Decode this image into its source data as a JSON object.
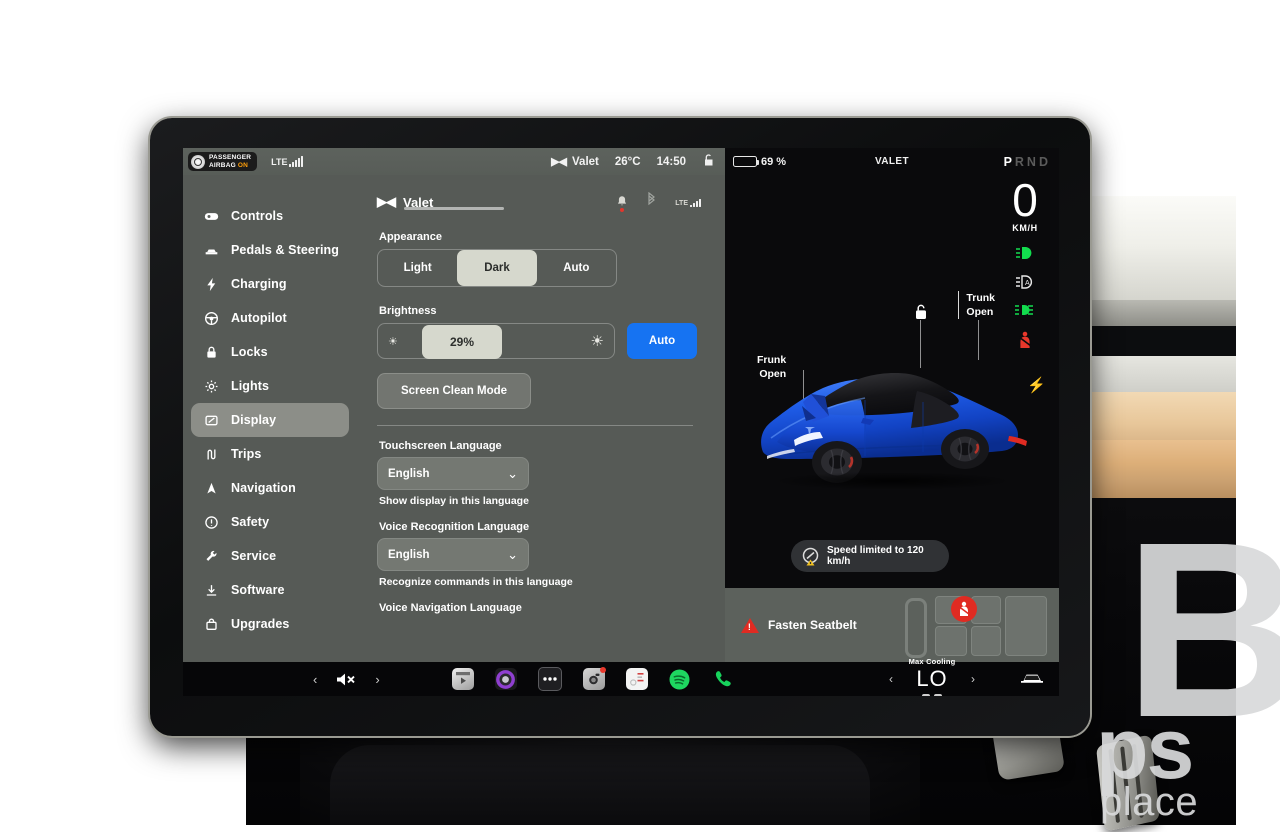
{
  "status_bar": {
    "airbag_badge": {
      "line1": "PASSENGER",
      "line2": "AIRBAG",
      "state": "ON"
    },
    "network_label": "LTE",
    "valet_label": "Valet",
    "temperature": "26°C",
    "time": "14:50"
  },
  "sidebar": {
    "items": [
      {
        "label": "Controls",
        "icon": "toggle-icon"
      },
      {
        "label": "Pedals & Steering",
        "icon": "car-icon"
      },
      {
        "label": "Charging",
        "icon": "bolt-icon"
      },
      {
        "label": "Autopilot",
        "icon": "steering-wheel-icon"
      },
      {
        "label": "Locks",
        "icon": "lock-icon"
      },
      {
        "label": "Lights",
        "icon": "sun-icon"
      },
      {
        "label": "Display",
        "icon": "display-icon"
      },
      {
        "label": "Trips",
        "icon": "road-icon"
      },
      {
        "label": "Navigation",
        "icon": "navigation-arrow-icon"
      },
      {
        "label": "Safety",
        "icon": "exclamation-circle-icon"
      },
      {
        "label": "Service",
        "icon": "wrench-icon"
      },
      {
        "label": "Software",
        "icon": "download-icon"
      },
      {
        "label": "Upgrades",
        "icon": "bag-icon"
      }
    ],
    "active": "Display"
  },
  "content": {
    "header_title": "Valet",
    "appearance": {
      "label": "Appearance",
      "options": [
        "Light",
        "Dark",
        "Auto"
      ],
      "selected": "Dark"
    },
    "brightness": {
      "label": "Brightness",
      "value": "29%",
      "auto_label": "Auto"
    },
    "screen_clean": "Screen Clean Mode",
    "touchscreen_language": {
      "label": "Touchscreen Language",
      "value": "English",
      "hint": "Show display in this language"
    },
    "voice_recognition_language": {
      "label": "Voice Recognition Language",
      "value": "English",
      "hint": "Recognize commands in this language"
    },
    "voice_navigation_language": {
      "label": "Voice Navigation Language"
    }
  },
  "vehicle": {
    "battery_percent": "69 %",
    "valet_mode": "VALET",
    "gear": {
      "all": "PRND",
      "selected": "P"
    },
    "speed": "0",
    "speed_unit": "KM/H",
    "trunk_status": {
      "line1": "Trunk",
      "line2": "Open"
    },
    "frunk_status": {
      "line1": "Frunk",
      "line2": "Open"
    },
    "speed_limit_notice": "Speed limited to 120 km/h",
    "indicators": [
      {
        "name": "high-beam-icon",
        "color": "#12dc4e"
      },
      {
        "name": "auto-beam-icon",
        "color": "#e8e8e8"
      },
      {
        "name": "fog-light-icon",
        "color": "#12dc4e"
      },
      {
        "name": "seatbelt-warning-icon",
        "color": "#e8372b"
      },
      {
        "name": "charge-bolt-icon",
        "color": "#ffffff"
      }
    ],
    "seatbelt_alert": "Fasten Seatbelt",
    "car_color": "#1550e0"
  },
  "taskbar": {
    "volume_prev": "‹",
    "volume_next": "›",
    "mute_icon": "volume-mute-icon",
    "apps": [
      {
        "name": "theater-app-icon"
      },
      {
        "name": "media-app-icon"
      },
      {
        "name": "more-apps-icon"
      },
      {
        "name": "camera-app-icon"
      },
      {
        "name": "tesla-toybox-icon"
      },
      {
        "name": "spotify-app-icon"
      },
      {
        "name": "phone-app-icon"
      }
    ],
    "climate": {
      "prev": "‹",
      "next": "›",
      "mode_label": "Max Cooling",
      "temperature": "LO"
    },
    "car_button": "car-icon"
  },
  "watermark": {
    "big": "B",
    "mid": "ps",
    "sub": "place"
  },
  "colors": {
    "accent_blue": "#1673f2",
    "panel_gray": "#5c615c",
    "selected_light": "#d6d8cd",
    "warning_red": "#e02b22",
    "green": "#12dc4e"
  }
}
